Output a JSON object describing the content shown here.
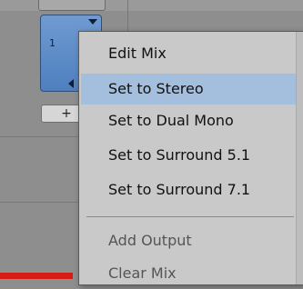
{
  "channel": {
    "number": "1",
    "add_label": "+"
  },
  "menu": {
    "items": [
      {
        "label": "Edit Mix",
        "selected": false
      },
      {
        "label": "Set to Stereo",
        "selected": true
      },
      {
        "label": "Set to Dual Mono",
        "selected": false
      },
      {
        "label": "Set to Surround 5.1",
        "selected": false
      },
      {
        "label": "Set to Surround 7.1",
        "selected": false
      },
      {
        "label": "Add Output",
        "selected": false
      },
      {
        "label": "Clear Mix",
        "selected": false
      }
    ]
  },
  "colors": {
    "selected_highlight": "#a3bfdd",
    "menu_background": "#c9c9c9",
    "tile_blue": "#5a8ac6",
    "record_red": "#d41c14"
  }
}
